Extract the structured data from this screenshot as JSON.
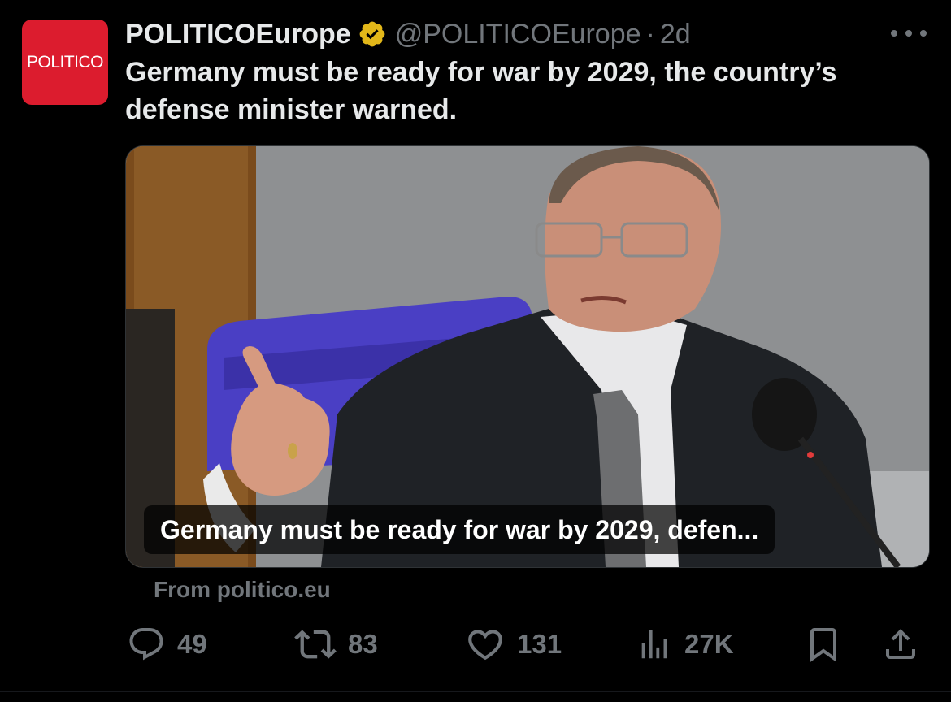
{
  "author": {
    "avatar_text": "POLITICO",
    "display_name": "POLITICOEurope",
    "handle": "@POLITICOEurope",
    "separator": "·",
    "time": "2d"
  },
  "tweet": {
    "text": "Germany must be ready for war by 2029, the country’s defense minister warned."
  },
  "card": {
    "caption": "Germany must be ready for war by 2029, defen...",
    "source": "From politico.eu"
  },
  "actions": {
    "replies": "49",
    "reposts": "83",
    "likes": "131",
    "views": "27K"
  },
  "icons": {
    "verified": "verified-gold-badge-icon",
    "more": "more-horizontal-icon",
    "reply": "reply-icon",
    "repost": "repost-icon",
    "like": "heart-icon",
    "views": "views-chart-icon",
    "bookmark": "bookmark-icon",
    "share": "share-icon"
  },
  "colors": {
    "background": "#000000",
    "text": "#e7e9ea",
    "muted": "#71767b",
    "brand_red": "#dc1c2e",
    "verified_gold": "#e2b719"
  }
}
